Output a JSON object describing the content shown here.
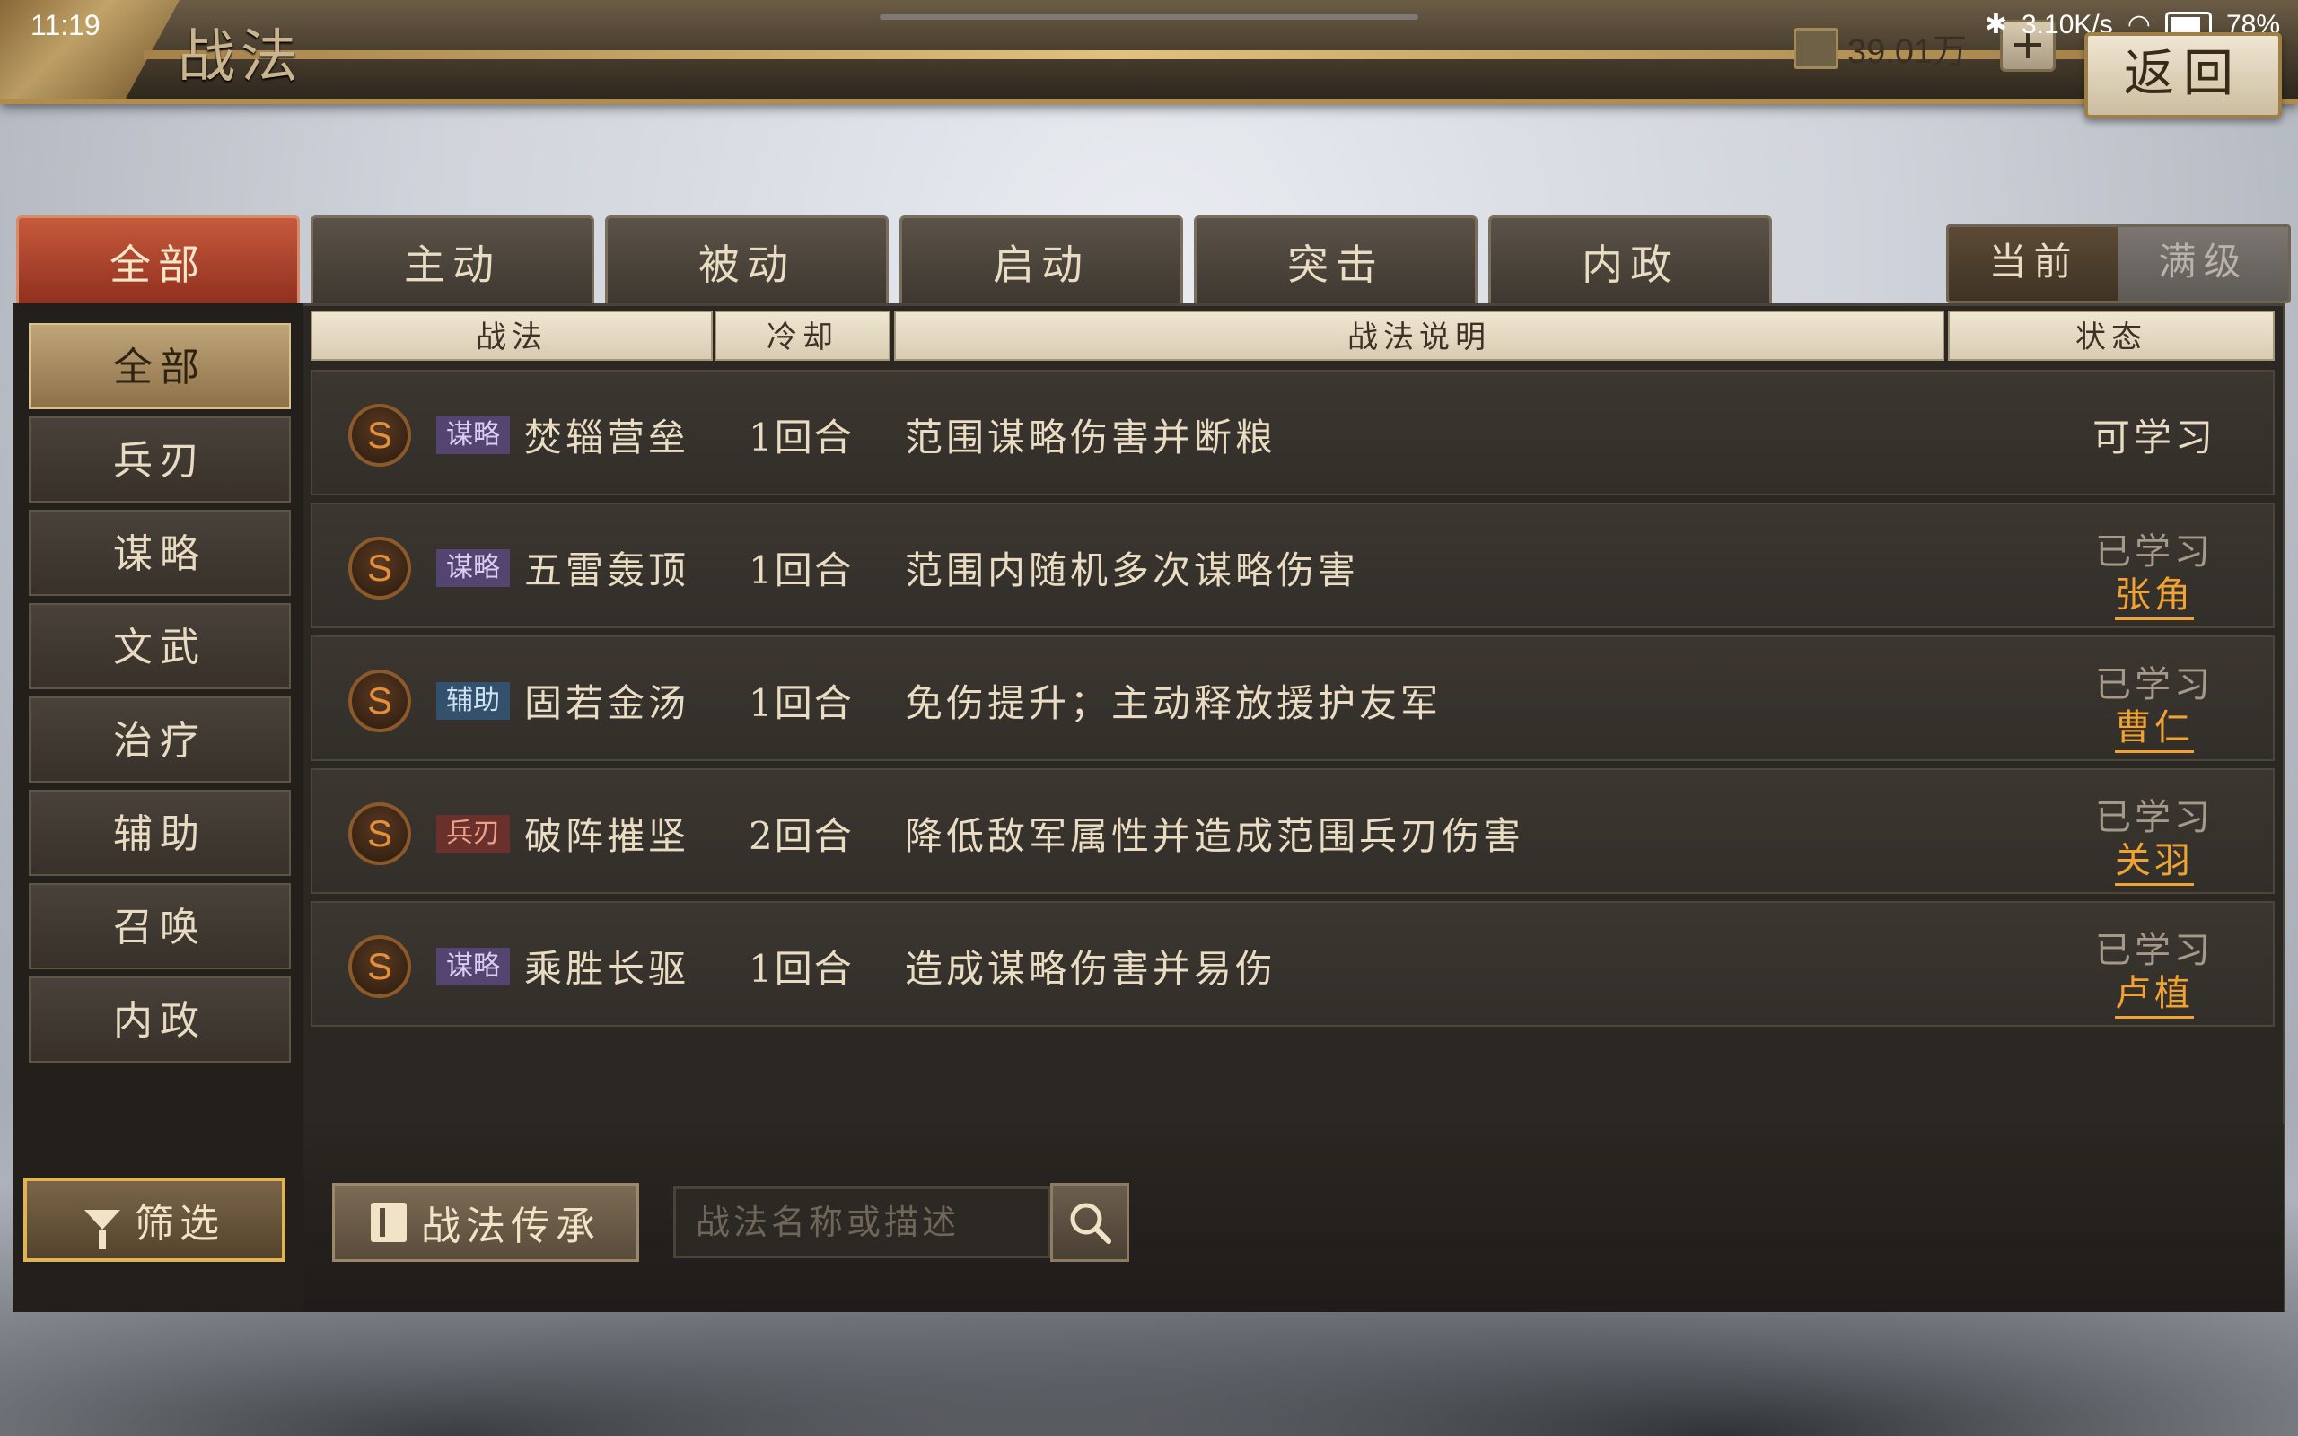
{
  "status_bar": {
    "time": "11:19",
    "net_speed": "3.10K/s",
    "battery": "78%"
  },
  "header": {
    "title": "战法",
    "currency": "39.01万",
    "add_label": "+",
    "back_label": "返回"
  },
  "top_tabs": [
    {
      "label": "全部",
      "active": true
    },
    {
      "label": "主动",
      "active": false
    },
    {
      "label": "被动",
      "active": false
    },
    {
      "label": "启动",
      "active": false
    },
    {
      "label": "突击",
      "active": false
    },
    {
      "label": "内政",
      "active": false
    }
  ],
  "level_toggle": {
    "current": "当前",
    "max": "满级"
  },
  "sidebar": {
    "items": [
      {
        "label": "全部",
        "active": true
      },
      {
        "label": "兵刃"
      },
      {
        "label": "谋略"
      },
      {
        "label": "文武"
      },
      {
        "label": "治疗"
      },
      {
        "label": "辅助"
      },
      {
        "label": "召唤"
      },
      {
        "label": "内政"
      }
    ],
    "filter_label": "筛选"
  },
  "table": {
    "headers": {
      "skill": "战法",
      "cooldown": "冷却",
      "description": "战法说明",
      "status": "状态"
    },
    "rows": [
      {
        "grade": "S",
        "type": "谋略",
        "name": "焚辎营垒",
        "cooldown": "1回合",
        "description": "范围谋略伤害并断粮",
        "status": "可学习",
        "general": ""
      },
      {
        "grade": "S",
        "type": "谋略",
        "name": "五雷轰顶",
        "cooldown": "1回合",
        "description": "范围内随机多次谋略伤害",
        "status": "已学习",
        "general": "张角"
      },
      {
        "grade": "S",
        "type": "辅助",
        "name": "固若金汤",
        "cooldown": "1回合",
        "description": "免伤提升；主动释放援护友军",
        "status": "已学习",
        "general": "曹仁"
      },
      {
        "grade": "S",
        "type": "兵刃",
        "name": "破阵摧坚",
        "cooldown": "2回合",
        "description": "降低敌军属性并造成范围兵刃伤害",
        "status": "已学习",
        "general": "关羽"
      },
      {
        "grade": "S",
        "type": "谋略",
        "name": "乘胜长驱",
        "cooldown": "1回合",
        "description": "造成谋略伤害并易伤",
        "status": "已学习",
        "general": "卢植"
      }
    ]
  },
  "bottom": {
    "inherit_label": "战法传承",
    "search_placeholder": "战法名称或描述"
  }
}
